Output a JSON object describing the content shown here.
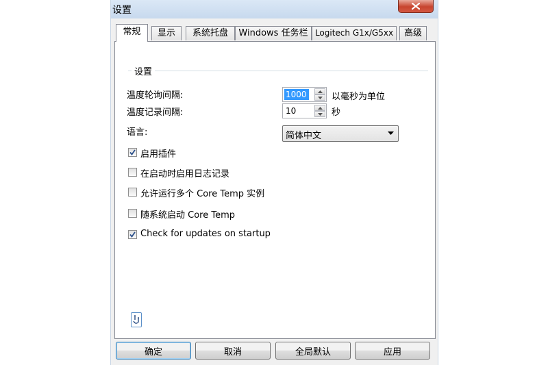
{
  "window": {
    "title": "设置",
    "close_icon": "close-icon"
  },
  "tabs": [
    {
      "label": "常规",
      "active": true
    },
    {
      "label": "显示",
      "active": false
    },
    {
      "label": "系统托盘",
      "active": false
    },
    {
      "label": "Windows 任务栏",
      "active": false
    },
    {
      "label": "Logitech G1x/G5xx",
      "active": false
    },
    {
      "label": "高级",
      "active": false
    }
  ],
  "general": {
    "group_label": "设置",
    "poll_interval": {
      "label": "温度轮询间隔:",
      "value": "1000",
      "unit": "以毫秒为单位"
    },
    "log_interval": {
      "label": "温度记录间隔:",
      "value": "10",
      "unit": "秒"
    },
    "language": {
      "label": "语言:",
      "selected": "简体中文"
    },
    "checkboxes": [
      {
        "label": "启用插件",
        "checked": true
      },
      {
        "label": "在启动时启用日志记录",
        "checked": false
      },
      {
        "label": "允许运行多个 Core Temp 实例",
        "checked": false
      },
      {
        "label": "随系统启动 Core Temp",
        "checked": false
      },
      {
        "label": "Check for updates on startup",
        "checked": true
      }
    ],
    "help_icon": "help-icon"
  },
  "buttons": {
    "ok": "确定",
    "cancel": "取消",
    "defaults": "全局默认",
    "apply": "应用"
  },
  "colors": {
    "selection": "#3399ff",
    "close_button": "#c7442e",
    "panel_border": "#898c95"
  }
}
